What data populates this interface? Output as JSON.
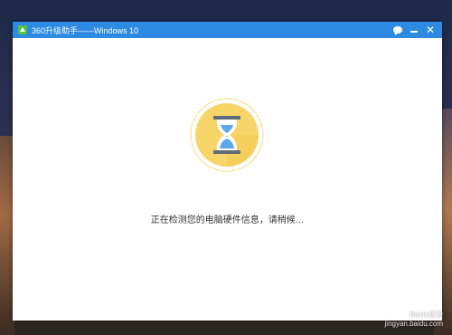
{
  "window": {
    "title": "360升级助手——Windows 10",
    "status_text": "正在检测您的电脑硬件信息，请稍候..."
  },
  "titlebar": {
    "icons": [
      "app-logo-icon",
      "chat-icon",
      "minimize-icon",
      "close-icon"
    ]
  },
  "colors": {
    "titlebar": "#2c8ae3",
    "hourglass_circle": "#f7d56a",
    "hourglass_frame": "#5f6b77",
    "sand": "#5aa7ea"
  },
  "watermark": {
    "line1": "Baidu经验",
    "line2": "jingyan.baidu.com"
  }
}
